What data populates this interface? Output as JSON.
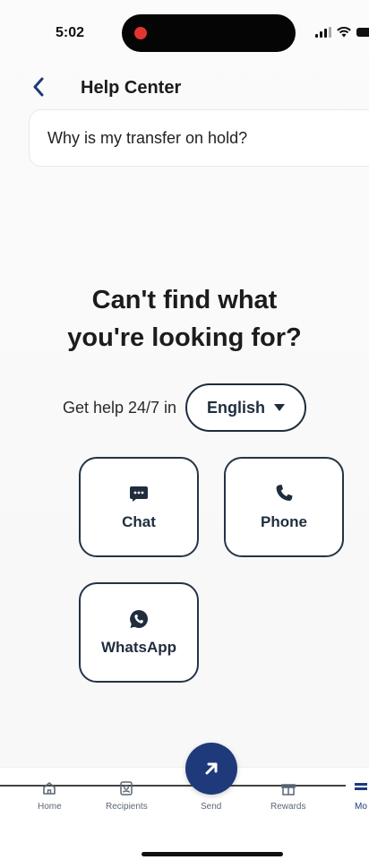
{
  "status_bar": {
    "time": "5:02"
  },
  "header": {
    "title": "Help Center",
    "back_icon": "chevron-left-icon"
  },
  "search": {
    "value": "Why is my transfer on hold?"
  },
  "help": {
    "heading": "Can't find what you're looking for?",
    "availability_text": "Get help 24/7 in",
    "language": "English",
    "contact_options": [
      {
        "label": "Chat",
        "icon": "chat-icon"
      },
      {
        "label": "Phone",
        "icon": "phone-icon"
      },
      {
        "label": "WhatsApp",
        "icon": "whatsapp-icon"
      }
    ]
  },
  "bottom_nav": {
    "items": [
      {
        "label": "Home",
        "icon": "home-icon"
      },
      {
        "label": "Recipients",
        "icon": "recipients-icon"
      },
      {
        "label": "Send",
        "icon": "send-icon"
      },
      {
        "label": "Rewards",
        "icon": "gift-icon"
      },
      {
        "label": "Mo",
        "icon": "more-icon"
      }
    ]
  },
  "colors": {
    "accent": "#1f3a7a",
    "outline": "#243447",
    "text": "#1f1f1f"
  }
}
